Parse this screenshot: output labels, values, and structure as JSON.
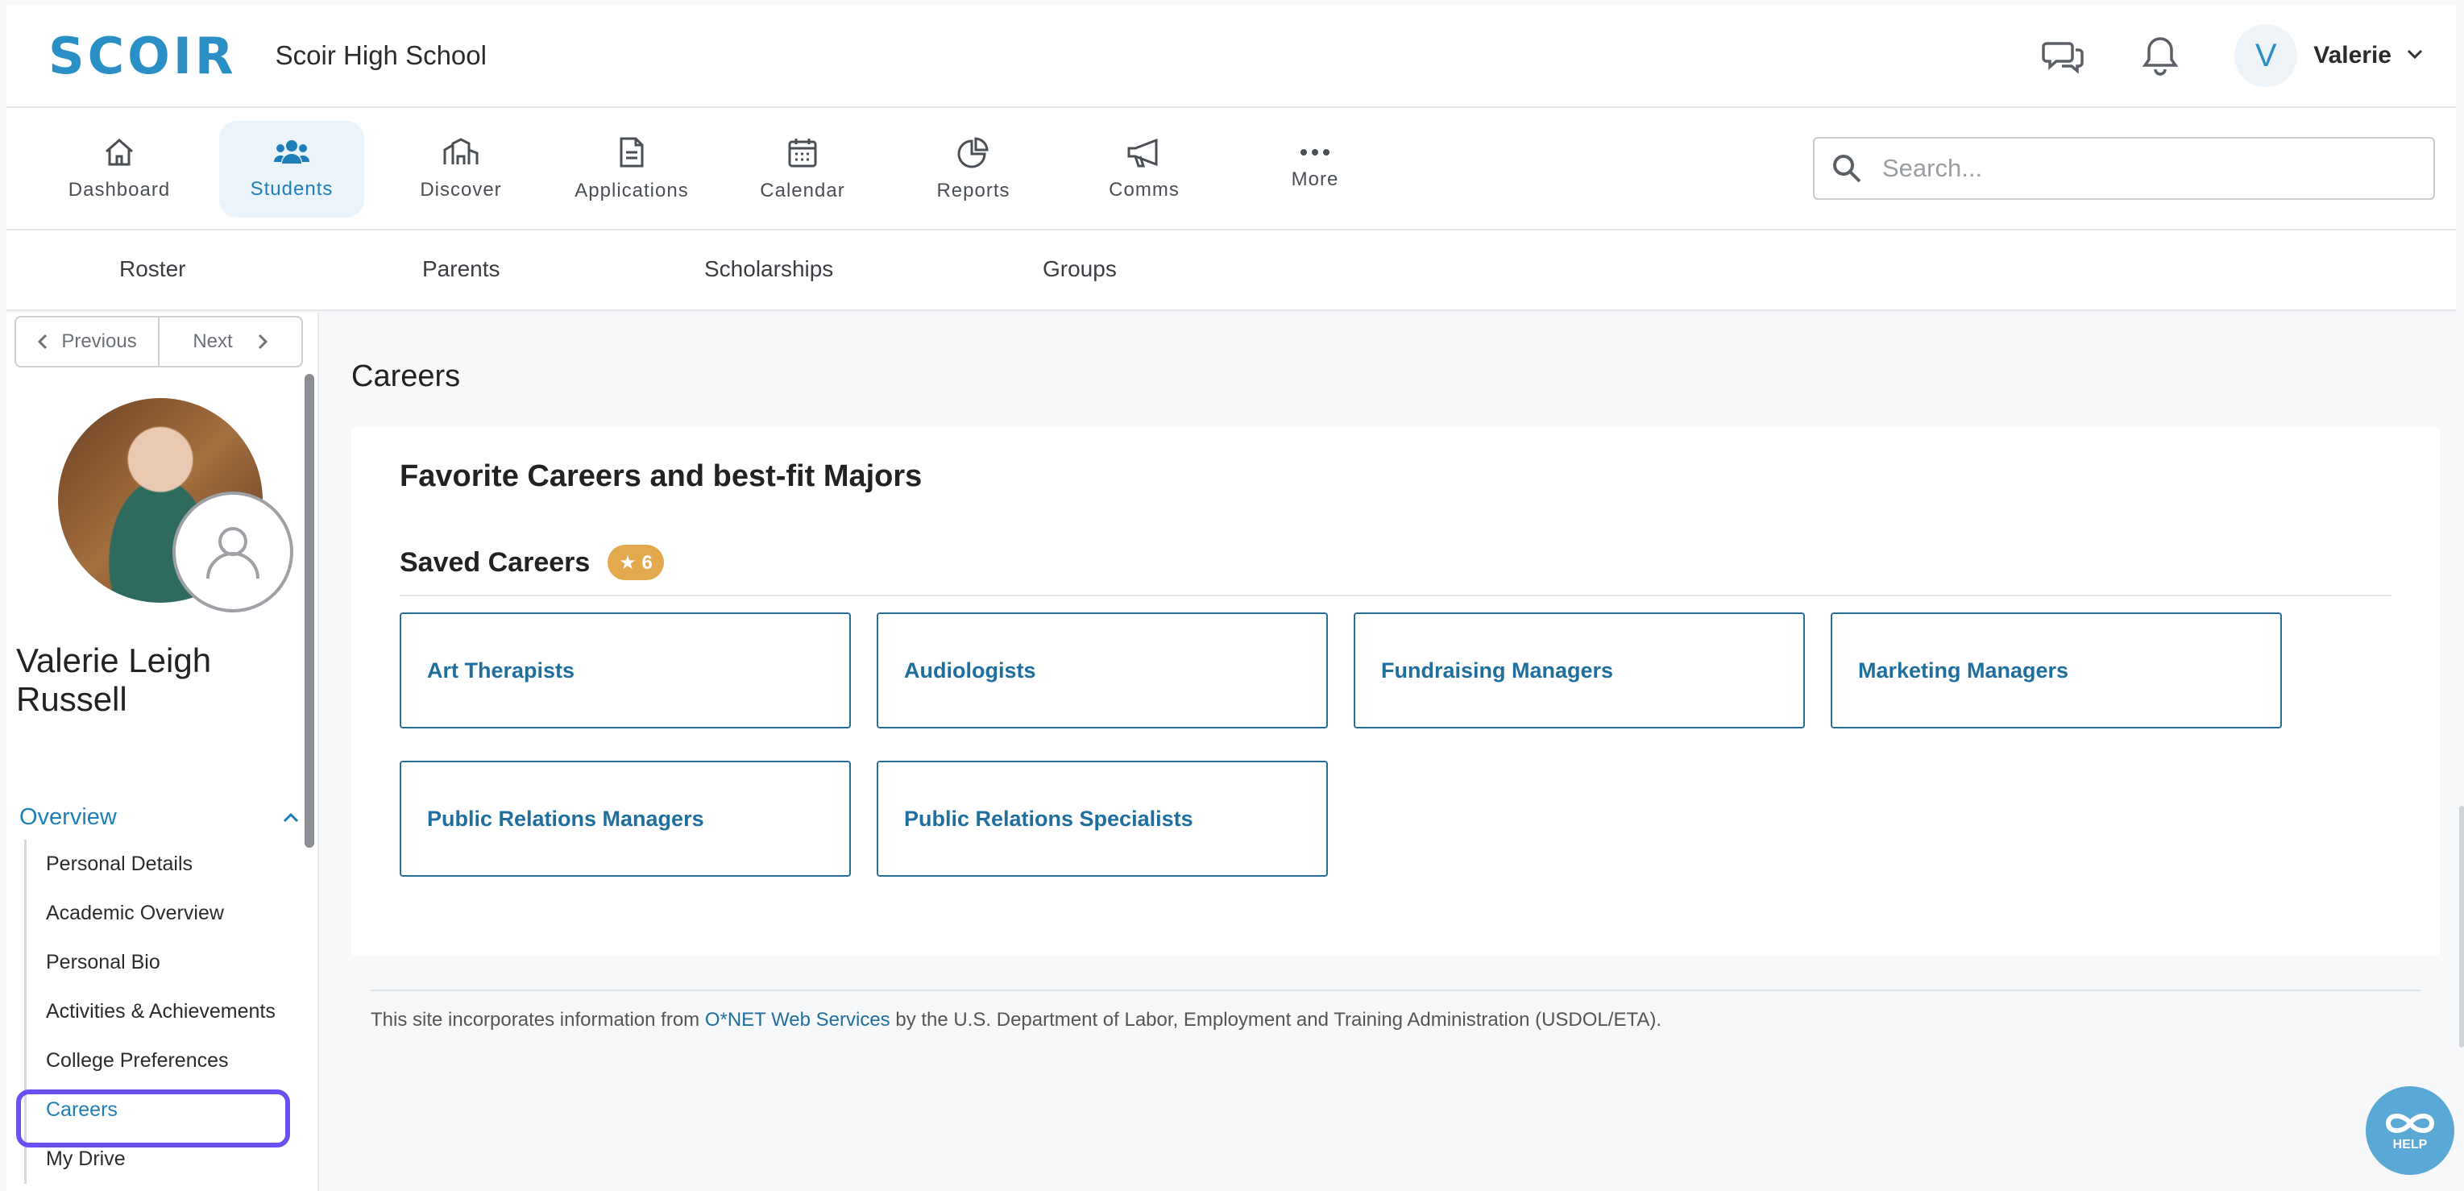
{
  "header": {
    "logo": "SCOIR",
    "school": "Scoir High School",
    "user_initial": "V",
    "user_name": "Valerie"
  },
  "nav": {
    "items": [
      {
        "label": "Dashboard",
        "icon": "home-icon"
      },
      {
        "label": "Students",
        "icon": "users-icon"
      },
      {
        "label": "Discover",
        "icon": "buildings-icon"
      },
      {
        "label": "Applications",
        "icon": "document-icon"
      },
      {
        "label": "Calendar",
        "icon": "calendar-icon"
      },
      {
        "label": "Reports",
        "icon": "pie-chart-icon"
      },
      {
        "label": "Comms",
        "icon": "megaphone-icon"
      },
      {
        "label": "More",
        "icon": "more-icon"
      }
    ],
    "active": "Students",
    "search_placeholder": "Search..."
  },
  "subnav": {
    "items": [
      "Roster",
      "Parents",
      "Scholarships",
      "Groups"
    ]
  },
  "sidebar": {
    "prev_label": "Previous",
    "next_label": "Next",
    "student_name": "Valerie Leigh Russell",
    "section_label": "Overview",
    "menu": [
      "Personal Details",
      "Academic Overview",
      "Personal Bio",
      "Activities & Achievements",
      "College Preferences",
      "Careers",
      "My Drive"
    ],
    "active_menu": "Careers"
  },
  "main": {
    "page_title": "Careers",
    "card_title": "Favorite Careers and best-fit Majors",
    "saved_label": "Saved Careers",
    "saved_count": "★ 6",
    "careers": [
      "Art Therapists",
      "Audiologists",
      "Fundraising Managers",
      "Marketing Managers",
      "Public Relations Managers",
      "Public Relations Specialists"
    ]
  },
  "footer": {
    "text_before": "This site incorporates information from ",
    "link_text": "O*NET Web Services",
    "text_after": " by the U.S. Department of Labor, Employment and Training Administration (USDOL/ETA)."
  },
  "help": {
    "label": "HELP"
  },
  "colors": {
    "brand": "#2a8fc4",
    "link": "#1f6f9e",
    "highlight": "#6b4ff0",
    "badge": "#e3aa4d"
  }
}
